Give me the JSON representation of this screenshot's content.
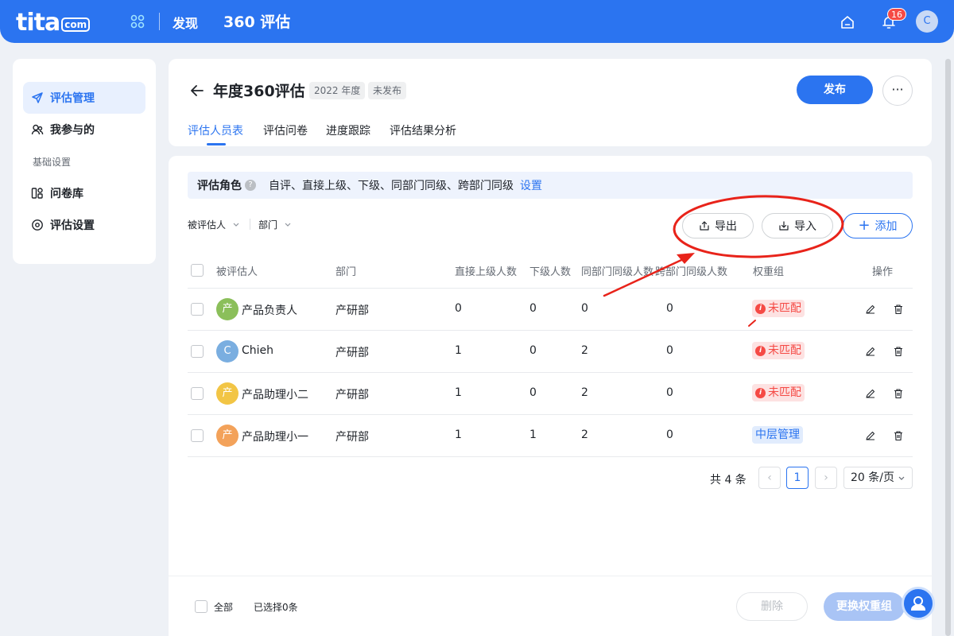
{
  "topbar": {
    "logo": "tita",
    "logo_suffix": "com",
    "nav_discover": "发现",
    "module_title": "360 评估",
    "notification_count": "16",
    "avatar_letter": "C"
  },
  "sidebar": {
    "items": [
      {
        "label": "评估管理",
        "icon": "send-icon"
      },
      {
        "label": "我参与的",
        "icon": "users-icon"
      }
    ],
    "group_label": "基础设置",
    "settings_items": [
      {
        "label": "问卷库",
        "icon": "library-icon"
      },
      {
        "label": "评估设置",
        "icon": "settings-icon"
      }
    ]
  },
  "header": {
    "title": "年度360评估",
    "year_tag": "2022 年度",
    "status_tag": "未发布",
    "publish_label": "发布",
    "more_label": "···",
    "tabs": [
      "评估人员表",
      "评估问卷",
      "进度跟踪",
      "评估结果分析"
    ]
  },
  "roles": {
    "label": "评估角色",
    "help": "?",
    "value": "自评、直接上级、下级、同部门同级、跨部门同级",
    "link": "设置"
  },
  "filters": {
    "evaluatee": "被评估人",
    "department": "部门"
  },
  "actions": {
    "export": "导出",
    "import": "导入",
    "add": "添加"
  },
  "table": {
    "headers": [
      "被评估人",
      "部门",
      "直接上级人数",
      "下级人数",
      "同部门同级人数",
      "跨部门同级人数",
      "权重组",
      "操作"
    ],
    "rows": [
      {
        "avatar": "产",
        "avatar_color": "#8bbf5a",
        "name": "产品负责人",
        "dept": "产研部",
        "superior": "0",
        "subordinate": "0",
        "same_dept": "0",
        "cross_dept": "0",
        "weight": "未匹配",
        "weight_ok": false
      },
      {
        "avatar": "C",
        "avatar_color": "#7aaee0",
        "name": "Chieh",
        "dept": "产研部",
        "superior": "1",
        "subordinate": "0",
        "same_dept": "2",
        "cross_dept": "0",
        "weight": "未匹配",
        "weight_ok": false
      },
      {
        "avatar": "产",
        "avatar_color": "#f2c545",
        "name": "产品助理小二",
        "dept": "产研部",
        "superior": "1",
        "subordinate": "0",
        "same_dept": "2",
        "cross_dept": "0",
        "weight": "未匹配",
        "weight_ok": false
      },
      {
        "avatar": "产",
        "avatar_color": "#f3a25a",
        "name": "产品助理小一",
        "dept": "产研部",
        "superior": "1",
        "subordinate": "1",
        "same_dept": "2",
        "cross_dept": "0",
        "weight": "中层管理",
        "weight_ok": true
      }
    ],
    "warn_mark": "i"
  },
  "pagination": {
    "total": "共 4 条",
    "prev": "‹",
    "current": "1",
    "next": "›",
    "page_size": "20 条/页"
  },
  "footer": {
    "select_all": "全部",
    "selected": "已选择0条",
    "delete": "删除",
    "change_weight": "更换权重组"
  },
  "colors": {
    "primary": "#2b74f0",
    "danger": "#f54a45",
    "annotation": "#e8231a"
  }
}
